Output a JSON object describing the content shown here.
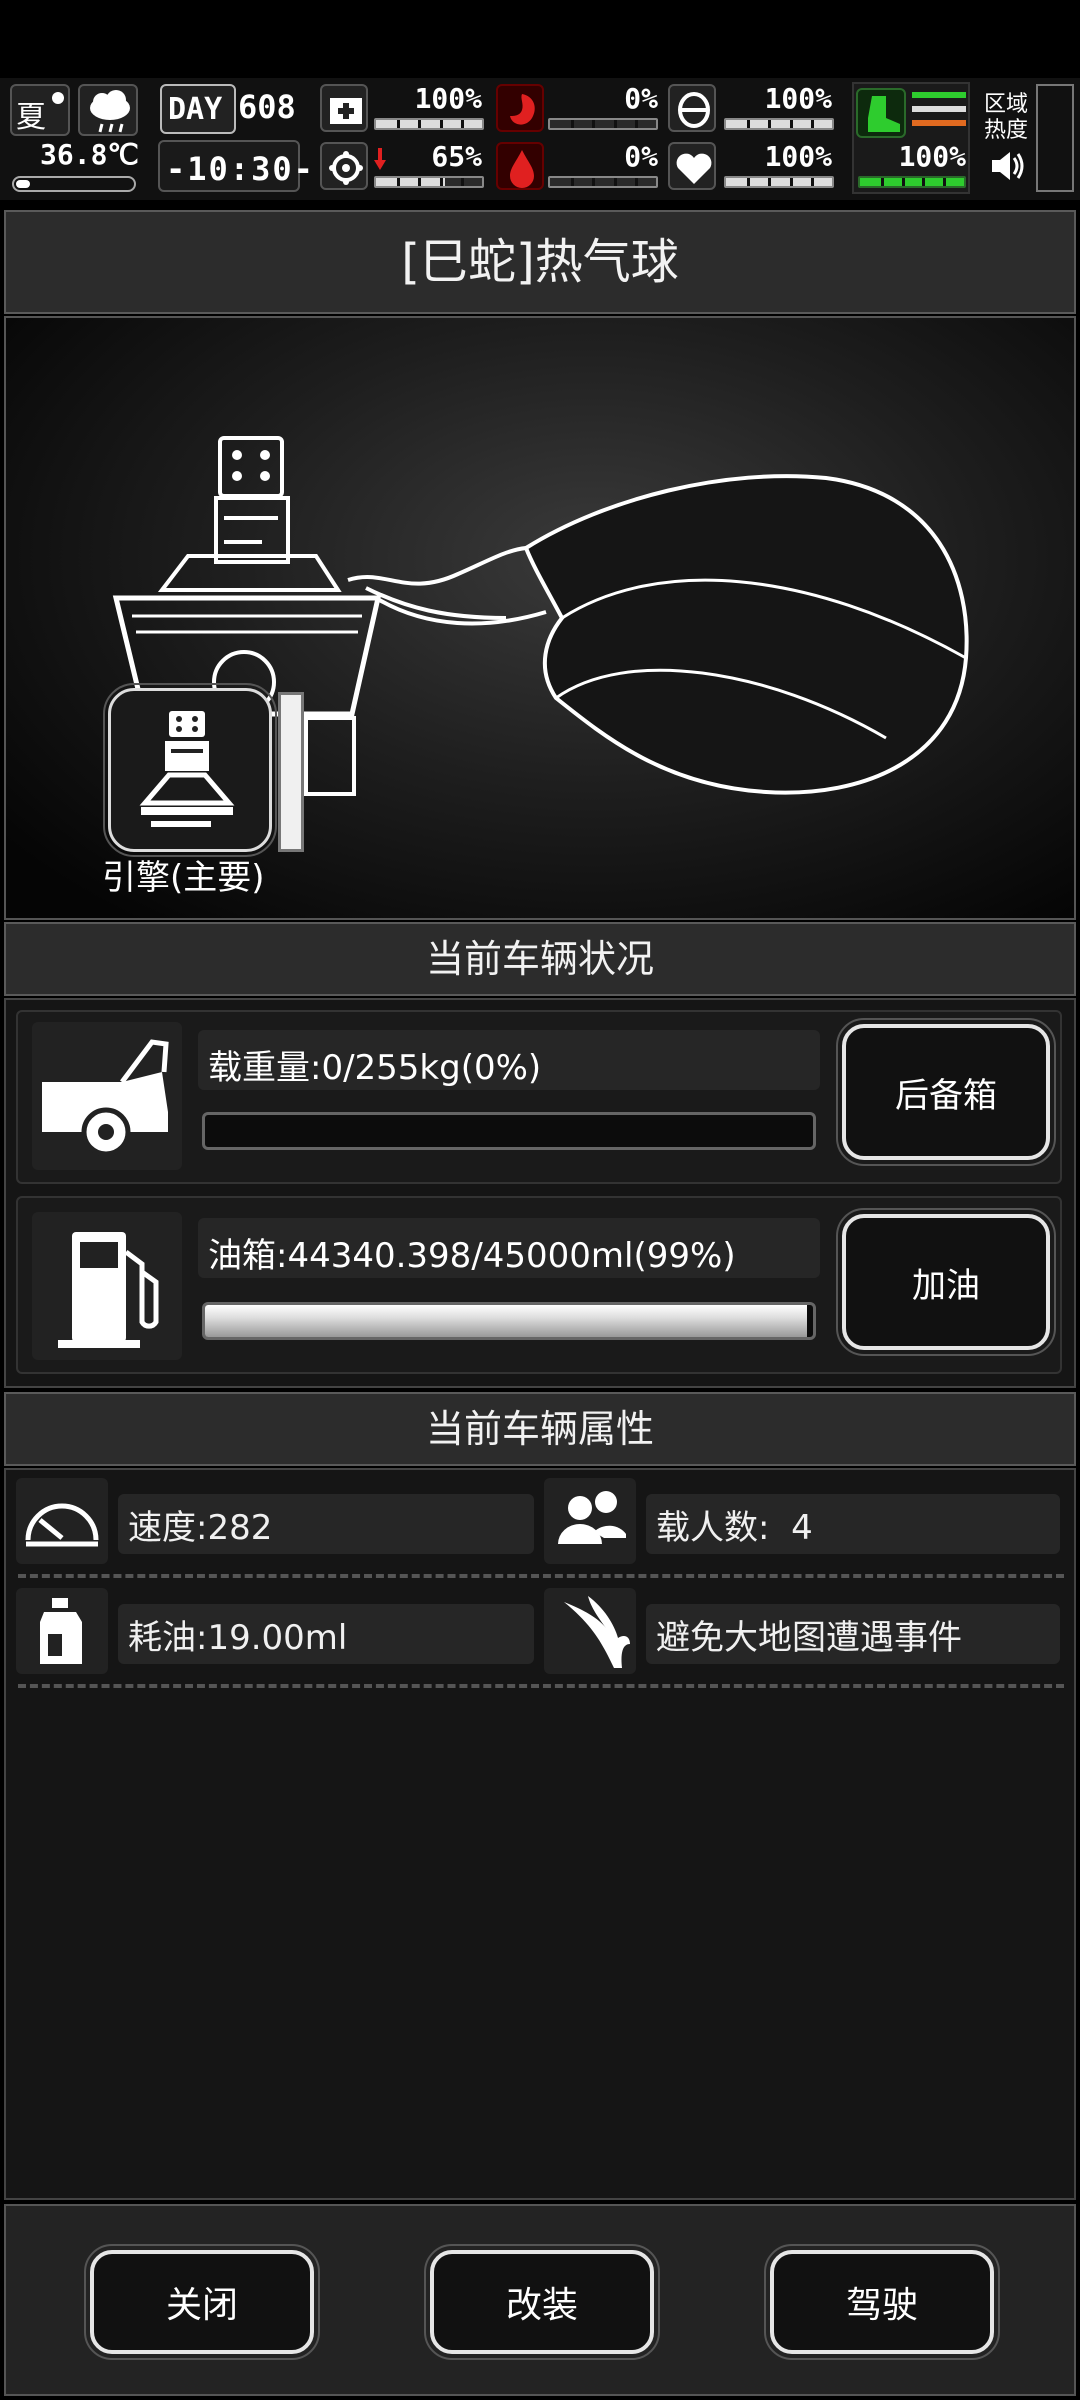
{
  "status": {
    "season": "夏",
    "temperature": "36.8℃",
    "day_label": "DAY",
    "day_number": "608",
    "time": "-10:30-",
    "health": {
      "value": "100%",
      "level": 1.0
    },
    "hunger": {
      "value": "0%",
      "level": 0.0
    },
    "armor": {
      "value": "100%",
      "level": 1.0
    },
    "infection": {
      "value": "65%",
      "level": 0.65
    },
    "bleeding": {
      "value": "0%",
      "level": 0.0
    },
    "mood": {
      "value": "100%",
      "level": 1.0
    },
    "stamina": {
      "value": "100%",
      "level": 1.0
    },
    "zone_heat_label": "区域热度"
  },
  "vehicle": {
    "title": "[巳蛇]热气球",
    "slot_label": "引擎(主要)"
  },
  "condition": {
    "header": "当前车辆状况",
    "load_text": "载重量:0/255kg(0%)",
    "load_level": 0.0,
    "trunk_button": "后备箱",
    "fuel_text": "油箱:44340.398/45000ml(99%)",
    "fuel_level": 0.99,
    "refuel_button": "加油"
  },
  "attributes": {
    "header": "当前车辆属性",
    "speed": "速度:282",
    "passengers": "载人数:  4",
    "fuel_use": "耗油:19.00ml",
    "avoid_events": "避免大地图遭遇事件"
  },
  "footer": {
    "close": "关闭",
    "modify": "改装",
    "drive": "驾驶"
  },
  "colors": {
    "stamina": "#2ecc2e",
    "danger": "#e02020"
  }
}
